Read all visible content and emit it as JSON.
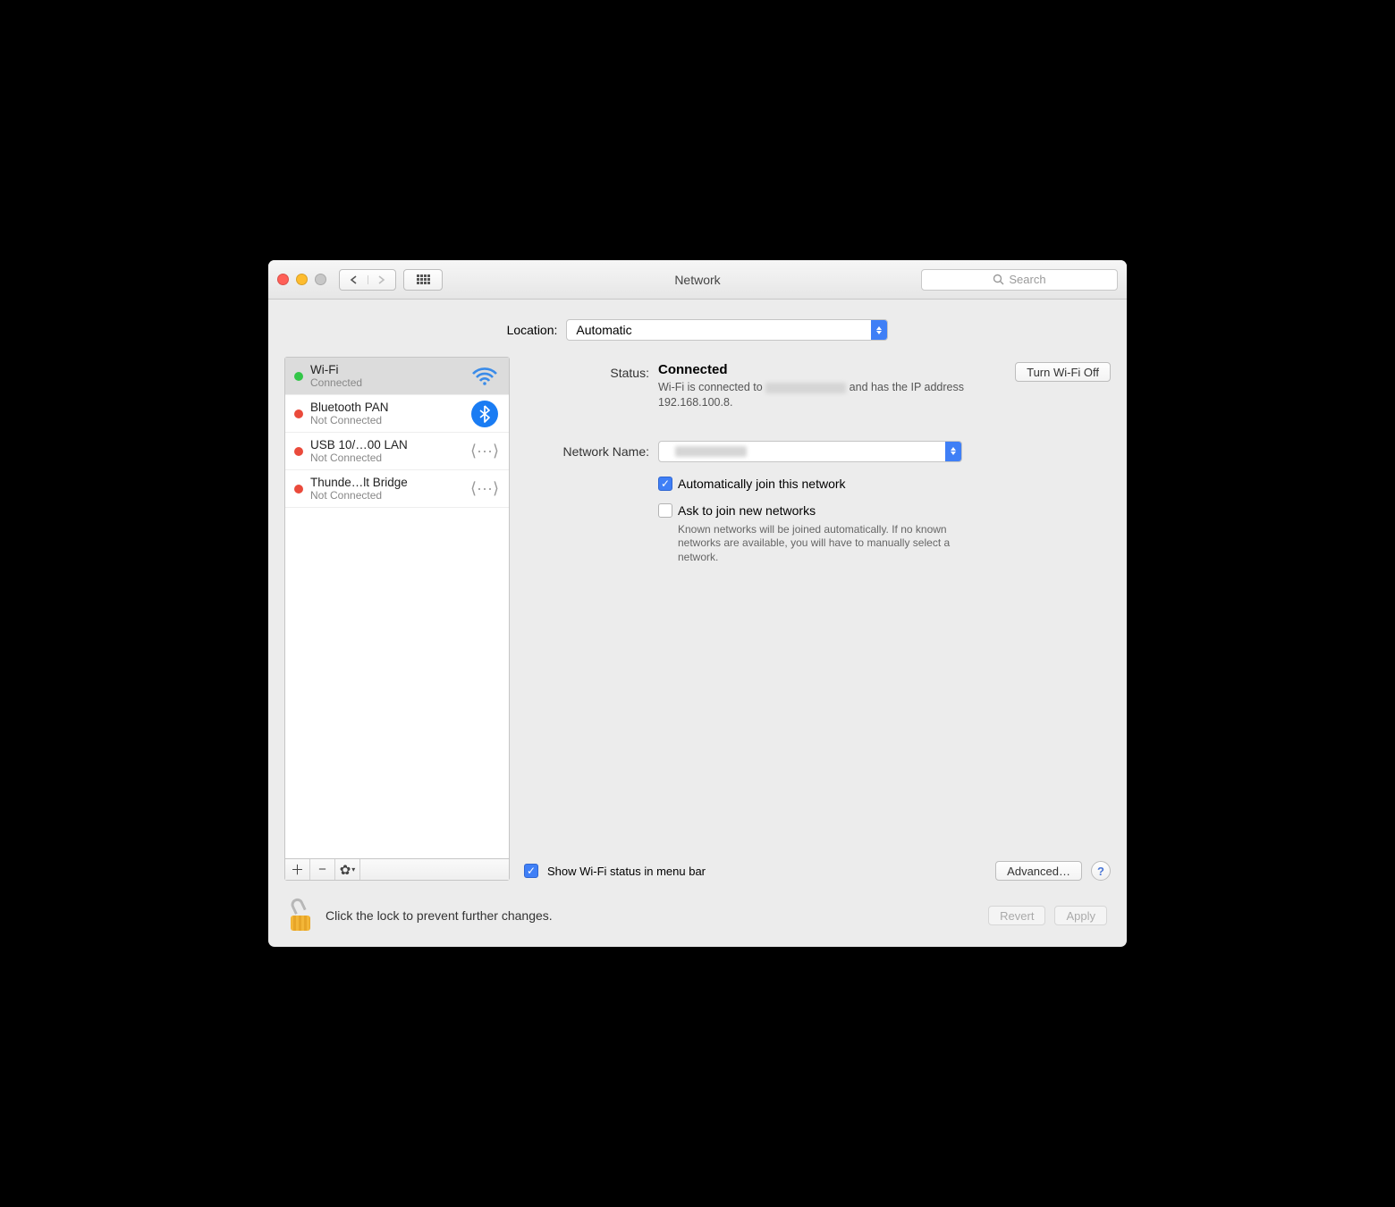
{
  "window": {
    "title": "Network"
  },
  "toolbar": {
    "searchPlaceholder": "Search"
  },
  "location": {
    "label": "Location:",
    "value": "Automatic"
  },
  "sidebar": {
    "items": [
      {
        "name": "Wi-Fi",
        "sub": "Connected",
        "status": "green",
        "icon": "wifi",
        "selected": true
      },
      {
        "name": "Bluetooth PAN",
        "sub": "Not Connected",
        "status": "red",
        "icon": "bluetooth"
      },
      {
        "name": "USB 10/…00 LAN",
        "sub": "Not Connected",
        "status": "red",
        "icon": "lan"
      },
      {
        "name": "Thunde…lt Bridge",
        "sub": "Not Connected",
        "status": "red",
        "icon": "lan"
      }
    ]
  },
  "detail": {
    "statusLabel": "Status:",
    "statusValue": "Connected",
    "toggleButton": "Turn Wi-Fi Off",
    "statusDescPrefix": "Wi-Fi is connected to ",
    "statusDescSuffix": " and has the IP address 192.168.100.8.",
    "networkNameLabel": "Network Name:",
    "autoJoinLabel": "Automatically join this network",
    "askJoinLabel": "Ask to join new networks",
    "askJoinHelp": "Known networks will be joined automatically. If no known networks are available, you will have to manually select a network.",
    "showMenuBarLabel": "Show Wi-Fi status in menu bar",
    "advancedButton": "Advanced…"
  },
  "footer": {
    "lockText": "Click the lock to prevent further changes.",
    "revert": "Revert",
    "apply": "Apply"
  }
}
